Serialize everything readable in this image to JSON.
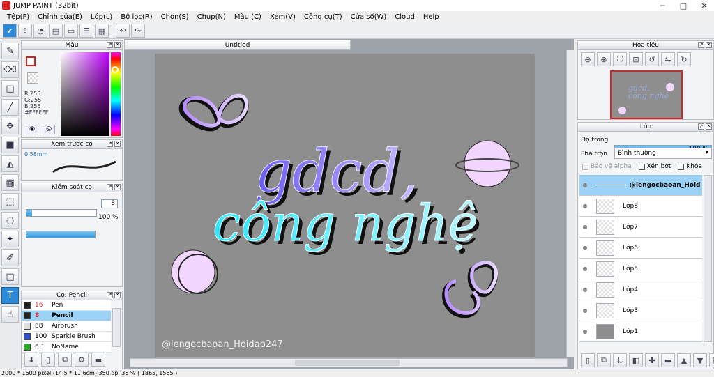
{
  "window": {
    "title": "JUMP PAINT (32bit)",
    "min": "─",
    "max": "□",
    "close": "✕"
  },
  "menu": [
    "Tệp(F)",
    "Chỉnh sửa(E)",
    "Lớp(L)",
    "Bộ lọc(R)",
    "Chọn(S)",
    "Chụp(N)",
    "Màu (C)",
    "Xem(V)",
    "Công cụ(T)",
    "Cửa sổ(W)",
    "Cloud",
    "Help"
  ],
  "toolbar": {
    "undo_icon": "undo-icon",
    "redo_icon": "redo-icon"
  },
  "color_panel": {
    "title": "Màu",
    "r": "R:255",
    "g": "G:255",
    "b": "B:255",
    "hex": "#FFFFFF",
    "accent_red": "#cc2222"
  },
  "brush_preview": {
    "title": "Xem trước cọ",
    "size": "0.58mm"
  },
  "brush_control": {
    "title": "Kiểm soát cọ",
    "size_value": "8",
    "opacity_value": "100 %",
    "opacity_fraction": 1.0,
    "size_fraction": 0.08
  },
  "brush_list": {
    "title": "Cọ: Pencil",
    "items": [
      {
        "size": "16",
        "name": "Pen",
        "color": "#222222",
        "size_color": "#d03030"
      },
      {
        "size": "8",
        "name": "Pencil",
        "color": "#222222",
        "size_color": "#d03030"
      },
      {
        "size": "88",
        "name": "Airbrush",
        "color": "#dddddd",
        "size_color": "#000000"
      },
      {
        "size": "100",
        "name": "Sparkle Brush",
        "color": "#3050d0",
        "size_color": "#000000"
      },
      {
        "size": "6.1",
        "name": "NoName",
        "color": "#20b020",
        "size_color": "#000000"
      }
    ]
  },
  "document": {
    "tab": "Untitled",
    "watermark": "@lengocbaoan_Hoidap247",
    "line1": "gdcd,",
    "line2": "công nghệ"
  },
  "navigator": {
    "title": "Hoa tiêu",
    "thumb_text": "gdcd, công nghệ"
  },
  "layers_panel": {
    "title": "Lớp",
    "opacity_label": "Độ trong",
    "opacity_value": "100 %",
    "opacity_fraction": 1.0,
    "blend_label": "Pha trộn",
    "blend_value": "Bình thường",
    "protect_alpha": "Bảo vệ alpha",
    "clipping": "Xén bớt",
    "lock": "Khóa",
    "layers": [
      {
        "name": "@lengocbaoan_Hoid"
      },
      {
        "name": "Lớp8"
      },
      {
        "name": "Lớp7"
      },
      {
        "name": "Lớp6"
      },
      {
        "name": "Lớp5"
      },
      {
        "name": "Lớp4"
      },
      {
        "name": "Lớp3"
      },
      {
        "name": "Lớp1"
      }
    ]
  },
  "status": {
    "text": "2000 * 1600 pixel  (14.5 * 11.6cm)  350 dpi  36 %  ( 1865, 1565 )"
  }
}
